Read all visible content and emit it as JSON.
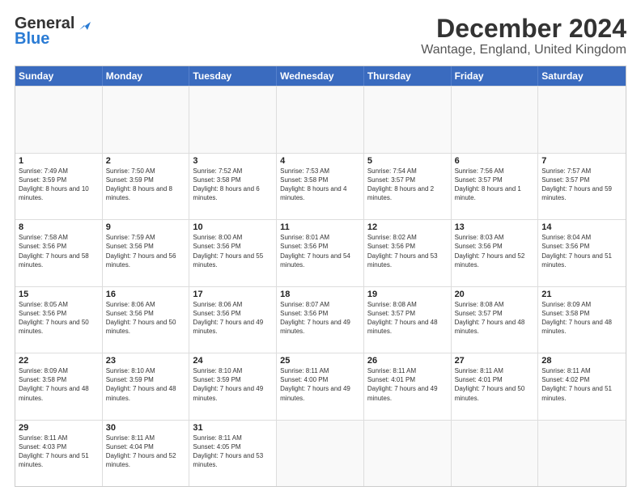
{
  "header": {
    "logo_line1": "General",
    "logo_line2": "Blue",
    "title": "December 2024",
    "subtitle": "Wantage, England, United Kingdom"
  },
  "calendar": {
    "days_of_week": [
      "Sunday",
      "Monday",
      "Tuesday",
      "Wednesday",
      "Thursday",
      "Friday",
      "Saturday"
    ],
    "weeks": [
      [
        {
          "day": "",
          "sunrise": "",
          "sunset": "",
          "daylight": ""
        },
        {
          "day": "",
          "sunrise": "",
          "sunset": "",
          "daylight": ""
        },
        {
          "day": "",
          "sunrise": "",
          "sunset": "",
          "daylight": ""
        },
        {
          "day": "",
          "sunrise": "",
          "sunset": "",
          "daylight": ""
        },
        {
          "day": "",
          "sunrise": "",
          "sunset": "",
          "daylight": ""
        },
        {
          "day": "",
          "sunrise": "",
          "sunset": "",
          "daylight": ""
        },
        {
          "day": "",
          "sunrise": "",
          "sunset": "",
          "daylight": ""
        }
      ],
      [
        {
          "day": "1",
          "sunrise": "Sunrise: 7:49 AM",
          "sunset": "Sunset: 3:59 PM",
          "daylight": "Daylight: 8 hours and 10 minutes."
        },
        {
          "day": "2",
          "sunrise": "Sunrise: 7:50 AM",
          "sunset": "Sunset: 3:59 PM",
          "daylight": "Daylight: 8 hours and 8 minutes."
        },
        {
          "day": "3",
          "sunrise": "Sunrise: 7:52 AM",
          "sunset": "Sunset: 3:58 PM",
          "daylight": "Daylight: 8 hours and 6 minutes."
        },
        {
          "day": "4",
          "sunrise": "Sunrise: 7:53 AM",
          "sunset": "Sunset: 3:58 PM",
          "daylight": "Daylight: 8 hours and 4 minutes."
        },
        {
          "day": "5",
          "sunrise": "Sunrise: 7:54 AM",
          "sunset": "Sunset: 3:57 PM",
          "daylight": "Daylight: 8 hours and 2 minutes."
        },
        {
          "day": "6",
          "sunrise": "Sunrise: 7:56 AM",
          "sunset": "Sunset: 3:57 PM",
          "daylight": "Daylight: 8 hours and 1 minute."
        },
        {
          "day": "7",
          "sunrise": "Sunrise: 7:57 AM",
          "sunset": "Sunset: 3:57 PM",
          "daylight": "Daylight: 7 hours and 59 minutes."
        }
      ],
      [
        {
          "day": "8",
          "sunrise": "Sunrise: 7:58 AM",
          "sunset": "Sunset: 3:56 PM",
          "daylight": "Daylight: 7 hours and 58 minutes."
        },
        {
          "day": "9",
          "sunrise": "Sunrise: 7:59 AM",
          "sunset": "Sunset: 3:56 PM",
          "daylight": "Daylight: 7 hours and 56 minutes."
        },
        {
          "day": "10",
          "sunrise": "Sunrise: 8:00 AM",
          "sunset": "Sunset: 3:56 PM",
          "daylight": "Daylight: 7 hours and 55 minutes."
        },
        {
          "day": "11",
          "sunrise": "Sunrise: 8:01 AM",
          "sunset": "Sunset: 3:56 PM",
          "daylight": "Daylight: 7 hours and 54 minutes."
        },
        {
          "day": "12",
          "sunrise": "Sunrise: 8:02 AM",
          "sunset": "Sunset: 3:56 PM",
          "daylight": "Daylight: 7 hours and 53 minutes."
        },
        {
          "day": "13",
          "sunrise": "Sunrise: 8:03 AM",
          "sunset": "Sunset: 3:56 PM",
          "daylight": "Daylight: 7 hours and 52 minutes."
        },
        {
          "day": "14",
          "sunrise": "Sunrise: 8:04 AM",
          "sunset": "Sunset: 3:56 PM",
          "daylight": "Daylight: 7 hours and 51 minutes."
        }
      ],
      [
        {
          "day": "15",
          "sunrise": "Sunrise: 8:05 AM",
          "sunset": "Sunset: 3:56 PM",
          "daylight": "Daylight: 7 hours and 50 minutes."
        },
        {
          "day": "16",
          "sunrise": "Sunrise: 8:06 AM",
          "sunset": "Sunset: 3:56 PM",
          "daylight": "Daylight: 7 hours and 50 minutes."
        },
        {
          "day": "17",
          "sunrise": "Sunrise: 8:06 AM",
          "sunset": "Sunset: 3:56 PM",
          "daylight": "Daylight: 7 hours and 49 minutes."
        },
        {
          "day": "18",
          "sunrise": "Sunrise: 8:07 AM",
          "sunset": "Sunset: 3:56 PM",
          "daylight": "Daylight: 7 hours and 49 minutes."
        },
        {
          "day": "19",
          "sunrise": "Sunrise: 8:08 AM",
          "sunset": "Sunset: 3:57 PM",
          "daylight": "Daylight: 7 hours and 48 minutes."
        },
        {
          "day": "20",
          "sunrise": "Sunrise: 8:08 AM",
          "sunset": "Sunset: 3:57 PM",
          "daylight": "Daylight: 7 hours and 48 minutes."
        },
        {
          "day": "21",
          "sunrise": "Sunrise: 8:09 AM",
          "sunset": "Sunset: 3:58 PM",
          "daylight": "Daylight: 7 hours and 48 minutes."
        }
      ],
      [
        {
          "day": "22",
          "sunrise": "Sunrise: 8:09 AM",
          "sunset": "Sunset: 3:58 PM",
          "daylight": "Daylight: 7 hours and 48 minutes."
        },
        {
          "day": "23",
          "sunrise": "Sunrise: 8:10 AM",
          "sunset": "Sunset: 3:59 PM",
          "daylight": "Daylight: 7 hours and 48 minutes."
        },
        {
          "day": "24",
          "sunrise": "Sunrise: 8:10 AM",
          "sunset": "Sunset: 3:59 PM",
          "daylight": "Daylight: 7 hours and 49 minutes."
        },
        {
          "day": "25",
          "sunrise": "Sunrise: 8:11 AM",
          "sunset": "Sunset: 4:00 PM",
          "daylight": "Daylight: 7 hours and 49 minutes."
        },
        {
          "day": "26",
          "sunrise": "Sunrise: 8:11 AM",
          "sunset": "Sunset: 4:01 PM",
          "daylight": "Daylight: 7 hours and 49 minutes."
        },
        {
          "day": "27",
          "sunrise": "Sunrise: 8:11 AM",
          "sunset": "Sunset: 4:01 PM",
          "daylight": "Daylight: 7 hours and 50 minutes."
        },
        {
          "day": "28",
          "sunrise": "Sunrise: 8:11 AM",
          "sunset": "Sunset: 4:02 PM",
          "daylight": "Daylight: 7 hours and 51 minutes."
        }
      ],
      [
        {
          "day": "29",
          "sunrise": "Sunrise: 8:11 AM",
          "sunset": "Sunset: 4:03 PM",
          "daylight": "Daylight: 7 hours and 51 minutes."
        },
        {
          "day": "30",
          "sunrise": "Sunrise: 8:11 AM",
          "sunset": "Sunset: 4:04 PM",
          "daylight": "Daylight: 7 hours and 52 minutes."
        },
        {
          "day": "31",
          "sunrise": "Sunrise: 8:11 AM",
          "sunset": "Sunset: 4:05 PM",
          "daylight": "Daylight: 7 hours and 53 minutes."
        },
        {
          "day": "",
          "sunrise": "",
          "sunset": "",
          "daylight": ""
        },
        {
          "day": "",
          "sunrise": "",
          "sunset": "",
          "daylight": ""
        },
        {
          "day": "",
          "sunrise": "",
          "sunset": "",
          "daylight": ""
        },
        {
          "day": "",
          "sunrise": "",
          "sunset": "",
          "daylight": ""
        }
      ]
    ]
  }
}
